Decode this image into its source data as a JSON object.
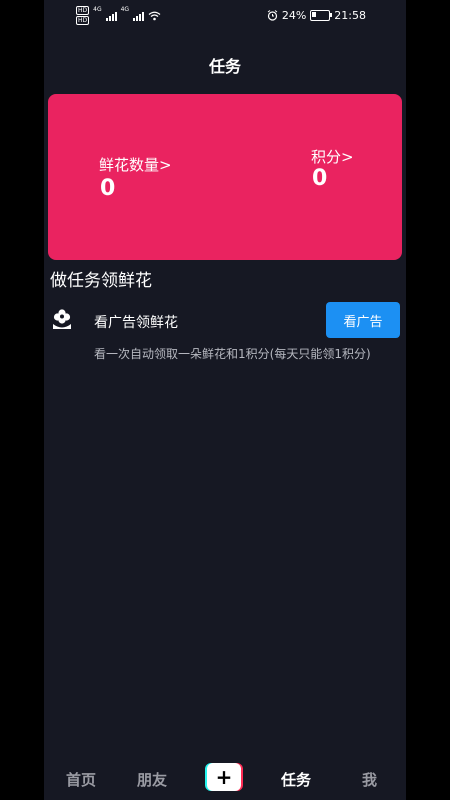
{
  "status_bar": {
    "battery": "24%",
    "time": "21:58",
    "net1": "4G",
    "net2": "4G",
    "hd": "HD"
  },
  "header": {
    "title": "任务"
  },
  "card": {
    "flowers_label": "鲜花数量>",
    "flowers_value": "0",
    "points_label": "积分>",
    "points_value": "0"
  },
  "section": {
    "title": "做任务领鲜花"
  },
  "task": {
    "label": "看广告领鲜花",
    "button_label": "看广告",
    "description": "看一次自动领取一朵鲜花和1积分(每天只能领1积分)"
  },
  "nav": {
    "home": "首页",
    "friends": "朋友",
    "add": "+",
    "tasks": "任务",
    "me": "我",
    "active": "任务"
  },
  "colors": {
    "background": "#161823",
    "card": "#ea2360",
    "button": "#1c90f3"
  }
}
